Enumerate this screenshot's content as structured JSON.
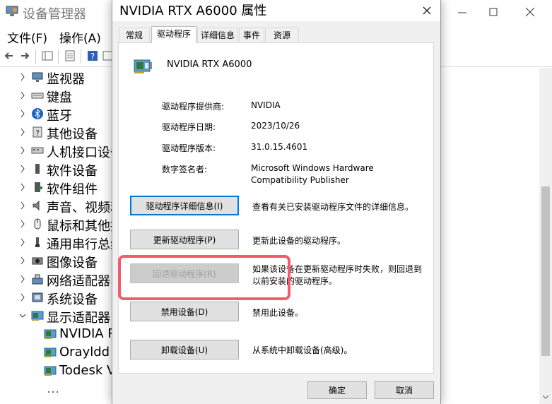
{
  "background_window": {
    "title": "设备管理器",
    "menu": [
      "文件(F)",
      "操作(A)"
    ],
    "tree": [
      {
        "label": "监视器",
        "icon": "monitor-icon",
        "expanded": false
      },
      {
        "label": "键盘",
        "icon": "keyboard-icon",
        "expanded": false
      },
      {
        "label": "蓝牙",
        "icon": "bluetooth-icon",
        "expanded": false
      },
      {
        "label": "其他设备",
        "icon": "other-devices-icon",
        "expanded": false
      },
      {
        "label": "人机接口设备",
        "icon": "hid-icon",
        "expanded": false
      },
      {
        "label": "软件设备",
        "icon": "software-device-icon",
        "expanded": false
      },
      {
        "label": "软件组件",
        "icon": "software-component-icon",
        "expanded": false
      },
      {
        "label": "声音、视频和",
        "icon": "speaker-icon",
        "expanded": false
      },
      {
        "label": "鼠标和其他指",
        "icon": "mouse-icon",
        "expanded": false
      },
      {
        "label": "通用串行总线",
        "icon": "usb-icon",
        "expanded": false
      },
      {
        "label": "图像设备",
        "icon": "camera-icon",
        "expanded": false
      },
      {
        "label": "网络适配器",
        "icon": "network-icon",
        "expanded": false
      },
      {
        "label": "系统设备",
        "icon": "system-device-icon",
        "expanded": false
      },
      {
        "label": "显示适配器",
        "icon": "display-adapter-icon",
        "expanded": true
      }
    ],
    "display_children": [
      "NVIDIA R",
      "Orayldd",
      "Todesk V"
    ],
    "last_partial": "…"
  },
  "dialog": {
    "title": "NVIDIA RTX A6000 属性",
    "tabs": [
      "常规",
      "驱动程序",
      "详细信息",
      "事件",
      "资源"
    ],
    "active_tab": "驱动程序",
    "device_name": "NVIDIA RTX A6000",
    "info": [
      {
        "label": "驱动程序提供商:",
        "value": "NVIDIA"
      },
      {
        "label": "驱动程序日期:",
        "value": "2023/10/26"
      },
      {
        "label": "驱动程序版本:",
        "value": "31.0.15.4601"
      },
      {
        "label": "数字签名者:",
        "value": "Microsoft Windows Hardware Compatibility Publisher"
      }
    ],
    "actions": [
      {
        "button": "驱动程序详细信息(I)",
        "desc": "查看有关已安装驱动程序文件的详细信息。",
        "enabled": true
      },
      {
        "button": "更新驱动程序(P)",
        "desc": "更新此设备的驱动程序。",
        "enabled": true
      },
      {
        "button": "回退驱动程序(R)",
        "desc": "如果该设备在更新驱动程序时失败，则回退到以前安装的驱动程序。",
        "enabled": false
      },
      {
        "button": "禁用设备(D)",
        "desc": "禁用此设备。",
        "enabled": true
      },
      {
        "button": "卸载设备(U)",
        "desc": "从系统中卸载设备(高级)。",
        "enabled": true
      }
    ],
    "ok": "确定",
    "cancel": "取消"
  },
  "colors": {
    "highlight": "#f25c6e",
    "focus_blue": "#0078d7"
  }
}
